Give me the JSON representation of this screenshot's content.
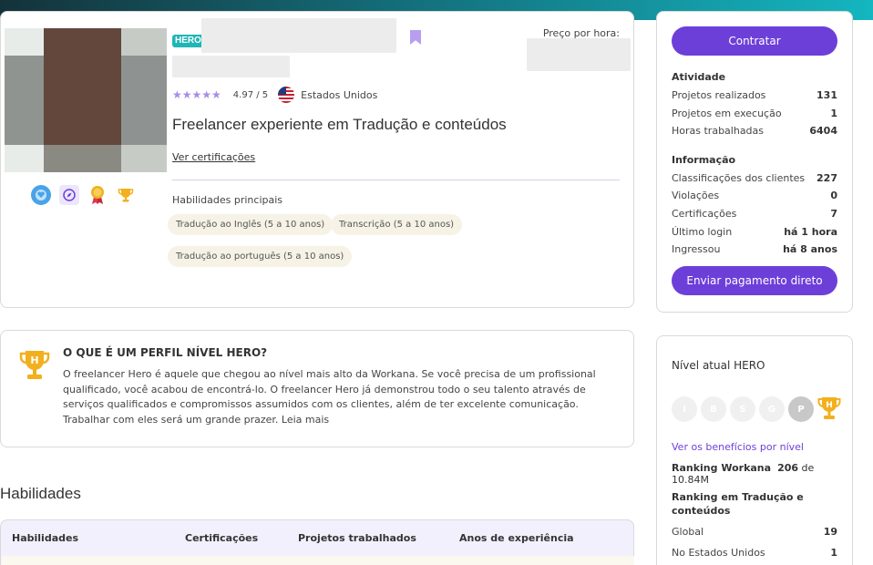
{
  "profile": {
    "tag": "HERO",
    "price_label": "Preço por hora:",
    "rating": "4.97 / 5",
    "country": "Estados Unidos",
    "headline": "Freelancer experiente em Tradução e conteúdos",
    "certifications_link": "Ver certificações",
    "skills_title": "Habilidades principais",
    "skills": [
      "Tradução ao Inglês (5 a 10 anos)",
      "Transcrição (5 a 10 anos)",
      "Tradução ao português (5 a 10 anos)"
    ],
    "rating_value": 4.97,
    "rating_max": 5
  },
  "sidebar": {
    "hire_button": "Contratar",
    "activity_title": "Atividade",
    "activity": [
      {
        "label": "Projetos realizados",
        "value": "131"
      },
      {
        "label": "Projetos em execução",
        "value": "1"
      },
      {
        "label": "Horas trabalhadas",
        "value": "6404"
      }
    ],
    "info_title": "Informação",
    "info": [
      {
        "label": "Classificações dos clientes",
        "value": "227"
      },
      {
        "label": "Violações",
        "value": "0"
      },
      {
        "label": "Certificações",
        "value": "7"
      },
      {
        "label": "Último login",
        "value": "há 1 hora"
      },
      {
        "label": "Ingressou",
        "value": "há 8 anos"
      }
    ],
    "payment_button": "Enviar pagamento direto"
  },
  "hero_info": {
    "title": "O QUE É UM PERFIL NÍVEL HERO?",
    "text": "O freelancer Hero é aquele que chegou ao nível mais alto da Workana. Se você precisa de um profissional qualificado, você acabou de encontrá-lo. O freelancer Hero já demonstrou todo o seu talento através de serviços qualificados e compromissos assumidos com os clientes, além de ter excelente comunicação. Trabalhar com eles será um grande prazer. Leia mais",
    "icon_letter": "H"
  },
  "skills_section": {
    "title": "Habilidades",
    "columns": [
      "Habilidades",
      "Certificações",
      "Projetos trabalhados",
      "Anos de experiência"
    ]
  },
  "level": {
    "title": "Nível atual HERO",
    "levels": [
      "I",
      "B",
      "S",
      "G",
      "P",
      "H"
    ],
    "benefits_link": "Ver os benefícios por nível",
    "ranking_label": "Ranking Workana",
    "ranking_value": "206",
    "ranking_total": "de 10.84M",
    "category_ranking_title": "Ranking em Tradução e conteúdos",
    "category_ranking": [
      {
        "label": "Global",
        "value": "19"
      },
      {
        "label": "No Estados Unidos",
        "value": "1"
      }
    ]
  },
  "colors": {
    "accent": "#6d3fd9",
    "hero_tag": "#1fb6b5",
    "star": "#a98be8",
    "trophy": "#f2b01e"
  },
  "icons": [
    "heart-badge-icon",
    "compass-badge-icon",
    "medal-icon",
    "trophy-icon",
    "bookmark-icon",
    "us-flag-icon",
    "hero-trophy-icon"
  ]
}
